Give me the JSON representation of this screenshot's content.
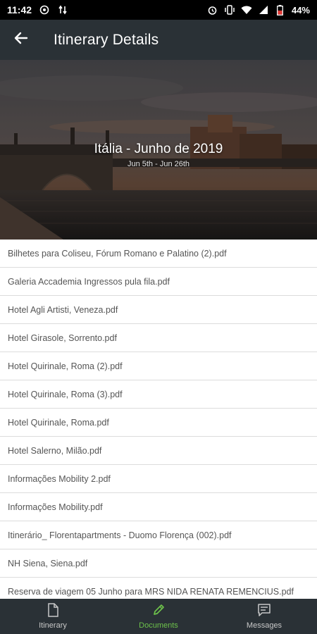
{
  "status_bar": {
    "time": "11:42",
    "battery": "44%",
    "icons": [
      "whatsapp-icon",
      "data-sync-icon",
      "alarm-icon",
      "vibrate-icon",
      "wifi-icon",
      "signal-icon",
      "battery-icon"
    ]
  },
  "app_bar": {
    "title": "Itinerary Details",
    "back_icon": "arrow-back-icon"
  },
  "hero": {
    "title": "Itália - Junho de 2019",
    "dates": "Jun 5th - Jun 26th"
  },
  "documents": [
    "Bilhetes para Coliseu, Fórum Romano e Palatino (2).pdf",
    "Galeria Accademia Ingressos pula fila.pdf",
    "Hotel Agli Artisti, Veneza.pdf",
    "Hotel Girasole, Sorrento.pdf",
    "Hotel Quirinale, Roma (2).pdf",
    "Hotel Quirinale, Roma (3).pdf",
    "Hotel Quirinale, Roma.pdf",
    "Hotel Salerno, Milão.pdf",
    "Informações Mobility 2.pdf",
    "Informações Mobility.pdf",
    "Itinerário_ Florentapartments - Duomo Florença (002).pdf",
    "NH Siena, Siena.pdf",
    "Reserva de viagem 05 Junho para MRS NIDA RENATA REMENCIUS.pdf"
  ],
  "bottom_nav": {
    "items": [
      {
        "label": "Itinerary",
        "icon": "document-icon"
      },
      {
        "label": "Documents",
        "icon": "pencil-icon"
      },
      {
        "label": "Messages",
        "icon": "message-icon"
      }
    ],
    "active": "Documents"
  },
  "colors": {
    "app_bar": "#2a3136",
    "accent": "#6dc24b",
    "status_bar": "#000000"
  }
}
